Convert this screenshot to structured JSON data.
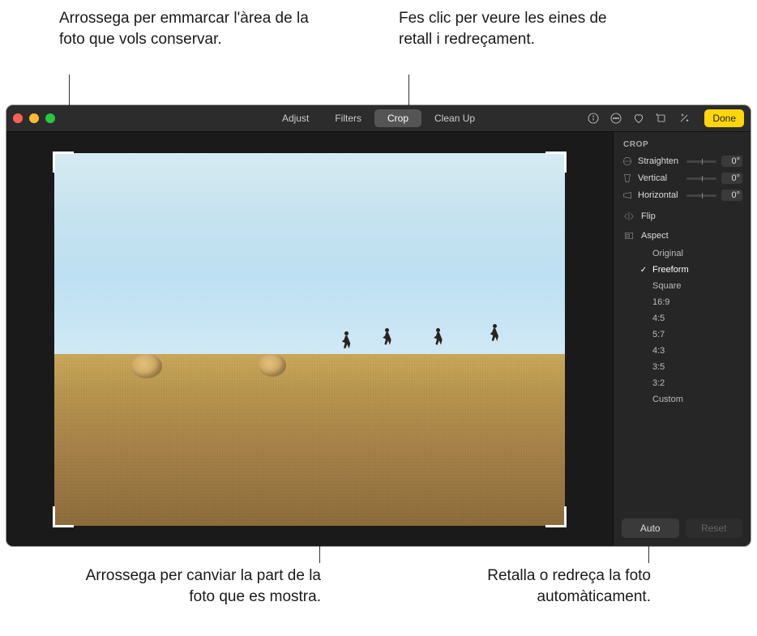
{
  "callouts": {
    "frame": "Arrossega per emmarcar l'àrea de la foto que vols conservar.",
    "crop_tools": "Fes clic per veure les eines de retall i redreçament.",
    "drag_photo": "Arrossega per canviar la part de la foto que es mostra.",
    "auto": "Retalla o redreça la foto automàticament."
  },
  "toolbar": {
    "tabs": {
      "adjust": "Adjust",
      "filters": "Filters",
      "crop": "Crop",
      "cleanup": "Clean Up"
    },
    "done": "Done"
  },
  "sidebar": {
    "title": "CROP",
    "sliders": {
      "straighten": {
        "label": "Straighten",
        "value": "0°"
      },
      "vertical": {
        "label": "Vertical",
        "value": "0°"
      },
      "horizontal": {
        "label": "Horizontal",
        "value": "0°"
      }
    },
    "flip": "Flip",
    "aspect": "Aspect",
    "aspects": {
      "original": "Original",
      "freeform": "Freeform",
      "square": "Square",
      "a169": "16:9",
      "a45": "4:5",
      "a57": "5:7",
      "a43": "4:3",
      "a35": "3:5",
      "a32": "3:2",
      "custom": "Custom"
    },
    "footer": {
      "auto": "Auto",
      "reset": "Reset"
    }
  }
}
